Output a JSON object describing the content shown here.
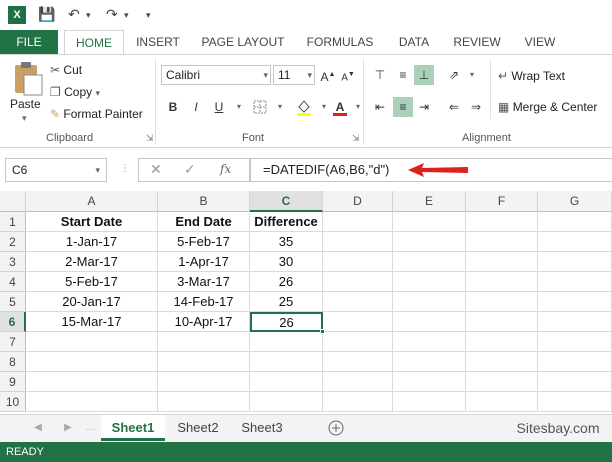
{
  "app": {
    "logo": "X",
    "qat_icons": [
      "save-icon",
      "undo-icon",
      "redo-icon"
    ]
  },
  "tabs": [
    "FILE",
    "HOME",
    "INSERT",
    "PAGE LAYOUT",
    "FORMULAS",
    "DATA",
    "REVIEW",
    "VIEW"
  ],
  "ribbon": {
    "paste": "Paste",
    "cut": "Cut",
    "copy": "Copy",
    "format_painter": "Format Painter",
    "clipboard": "Clipboard",
    "font_name": "Calibri",
    "font_size": "11",
    "font": "Font",
    "bold": "B",
    "italic": "I",
    "underline": "U",
    "font_color_letter": "A",
    "wrap_text": "Wrap Text",
    "merge_center": "Merge & Center",
    "alignment": "Alignment"
  },
  "formula_bar": {
    "name_box": "C6",
    "fx": "fx",
    "formula": "=DATEDIF(A6,B6,\"d\")"
  },
  "columns": [
    "A",
    "B",
    "C",
    "D",
    "E",
    "F",
    "G"
  ],
  "rows": [
    "1",
    "2",
    "3",
    "4",
    "5",
    "6",
    "7",
    "8",
    "9",
    "10"
  ],
  "table": {
    "headers": [
      "Start Date",
      "End Date",
      "Difference"
    ],
    "data": [
      [
        "1-Jan-17",
        "5-Feb-17",
        "35"
      ],
      [
        "2-Mar-17",
        "1-Apr-17",
        "30"
      ],
      [
        "5-Feb-17",
        "3-Mar-17",
        "26"
      ],
      [
        "20-Jan-17",
        "14-Feb-17",
        "25"
      ],
      [
        "15-Mar-17",
        "10-Apr-17",
        "26"
      ]
    ]
  },
  "sheets": [
    "Sheet1",
    "Sheet2",
    "Sheet3"
  ],
  "watermark": "Sitesbay.com",
  "status": "READY",
  "colors": {
    "accent": "#217346",
    "arrow": "#e0201b"
  }
}
